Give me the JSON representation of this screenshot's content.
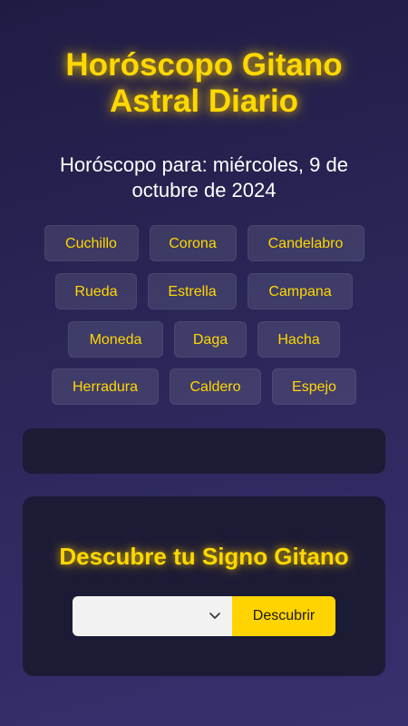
{
  "header": {
    "title_line1": "Horóscopo Gitano",
    "title_line2": "Astral Diario",
    "date_text": "Horóscopo para: miércoles, 9 de octubre de 2024"
  },
  "signs": {
    "row1": [
      "Cuchillo",
      "Corona",
      "Candelabro"
    ],
    "row2": [
      "Rueda",
      "Estrella",
      "Campana"
    ],
    "row3": [
      "Moneda",
      "Daga",
      "Hacha"
    ],
    "row4": [
      "Herradura",
      "Caldero",
      "Espejo"
    ]
  },
  "result": {
    "text": ""
  },
  "discover": {
    "title": "Descubre tu Signo Gitano",
    "select_value": "",
    "button_label": "Descubrir"
  },
  "colors": {
    "accent": "#ffd800",
    "background": "#2a2658",
    "panel": "#1c1b36",
    "button": "#ffd400"
  },
  "icons": {
    "select_arrow": "chevron-down-icon"
  }
}
